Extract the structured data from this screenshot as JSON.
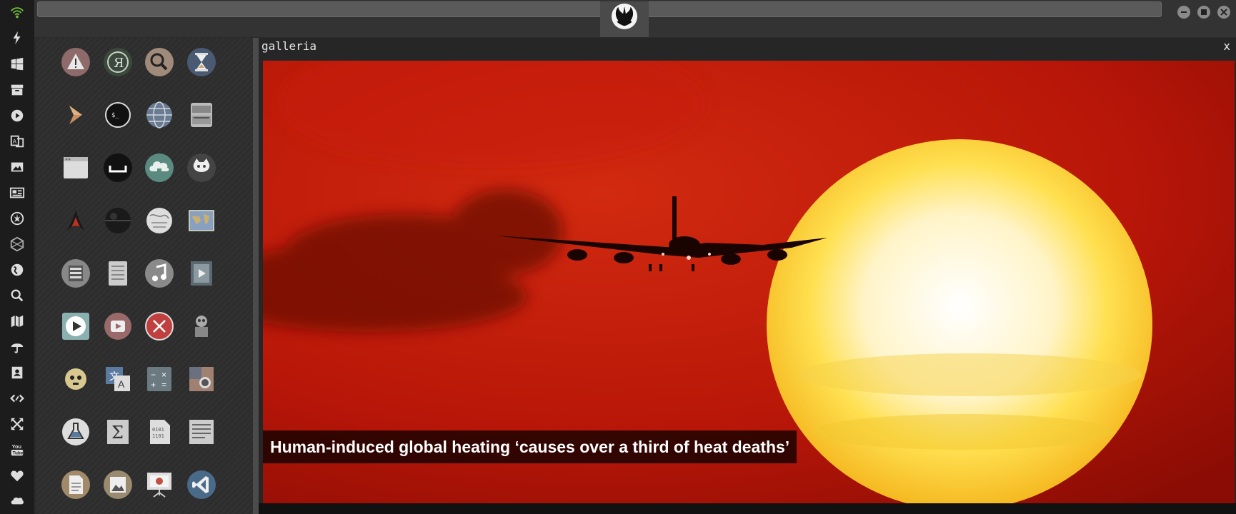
{
  "window": {
    "minimize_icon": "minimize-icon",
    "maximize_icon": "maximize-icon",
    "close_icon": "close-icon",
    "logo_icon": "rebel-alliance-icon"
  },
  "dock": {
    "items": [
      "wifi-icon",
      "lightning-icon",
      "windows-icon",
      "archive-icon",
      "play-icon",
      "translate-icon",
      "image-icon",
      "news-icon",
      "rebel-icon",
      "hexagon-icon",
      "globe-icon",
      "search-icon",
      "map-icon",
      "umbrella-icon",
      "contacts-icon",
      "code-icon",
      "expand-icon",
      "youtube-icon",
      "heart-icon",
      "cloud-icon"
    ],
    "accent": "#6fbf3a"
  },
  "apps": [
    "warning-icon",
    "yandex-icon",
    "search-icon",
    "hourglass-icon",
    "arrow-icon",
    "terminal-icon",
    "globe-icon",
    "drive-icon",
    "window-icon",
    "sleep-icon",
    "cloud-lock-icon",
    "github-icon",
    "starfleet-icon",
    "death-star-icon",
    "wikipedia-icon",
    "world-map-icon",
    "file-manager-icon",
    "notebook-icon",
    "music-icon",
    "video-icon",
    "player-icon",
    "youtube-icon",
    "xchat-icon",
    "robot-icon",
    "c3po-icon",
    "translate-icon",
    "calculator-icon",
    "screenshot-icon",
    "chemistry-icon",
    "math-icon",
    "binary-file-icon",
    "text-editor-icon",
    "document-icon",
    "image-viewer-icon",
    "presentation-icon",
    "vscode-icon"
  ],
  "gallery": {
    "title": "galleria",
    "close_label": "x",
    "caption": "Human-induced global heating ‘causes over a third of heat deaths’"
  }
}
